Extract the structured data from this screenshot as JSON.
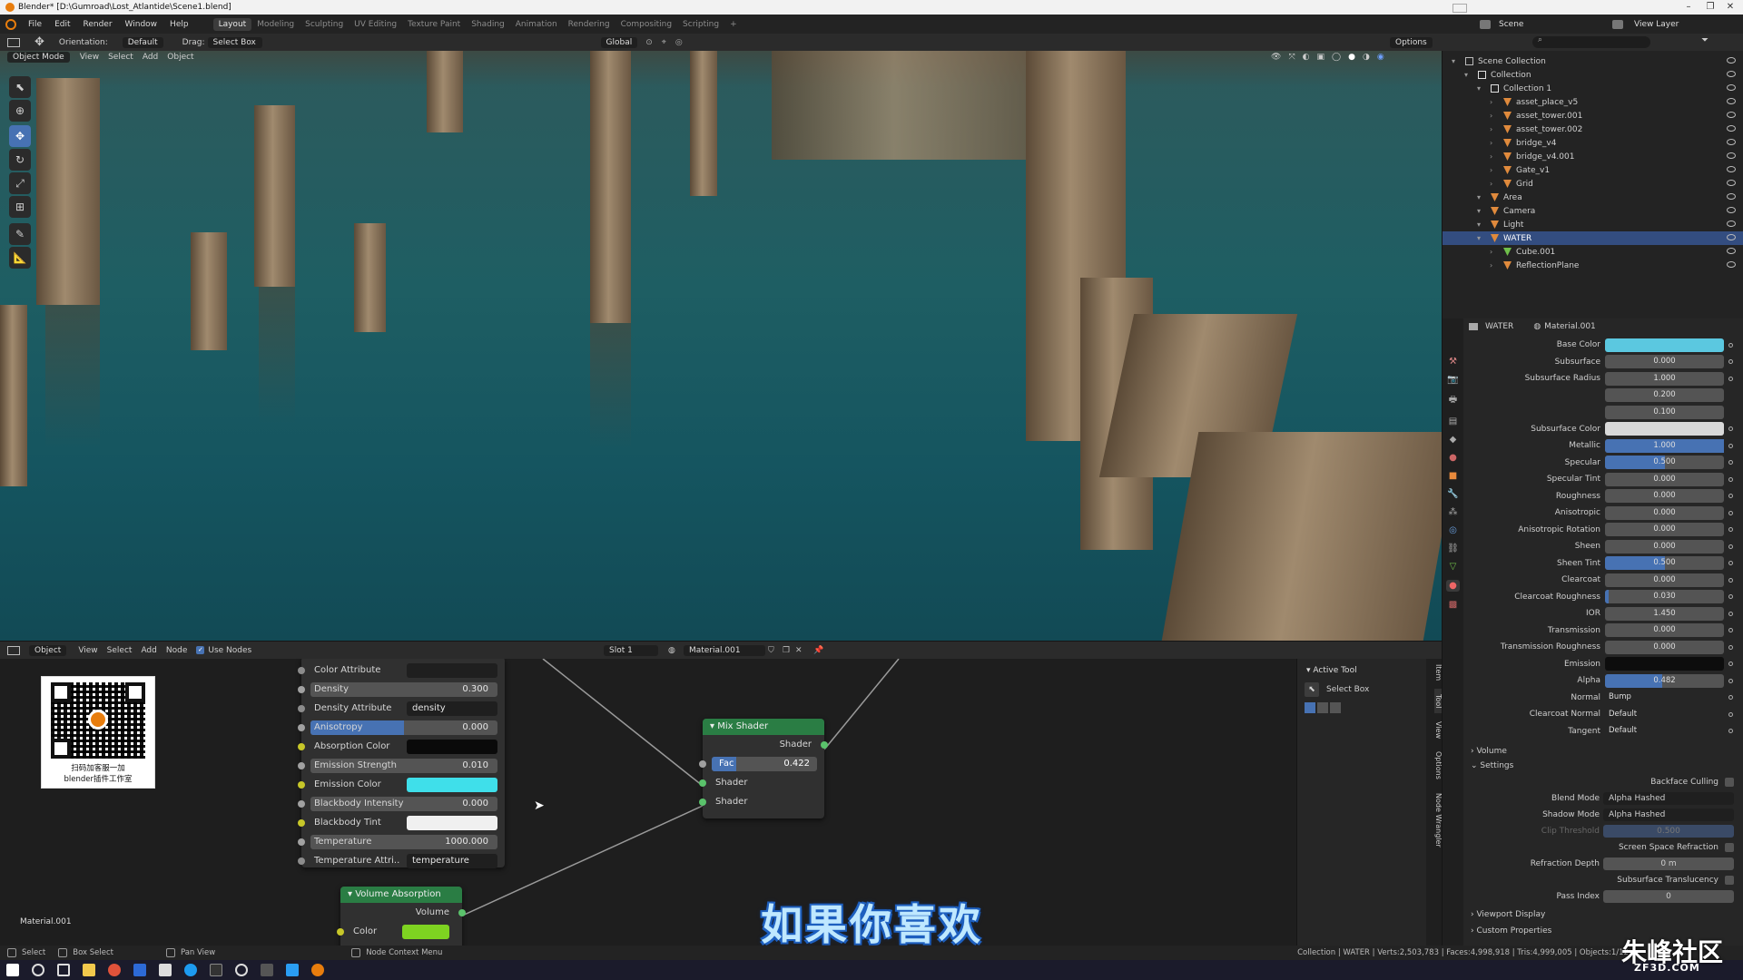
{
  "window": {
    "title": "Blender* [D:\\Gumroad\\Lost_Atlantide\\Scene1.blend]"
  },
  "menu": {
    "items": [
      "File",
      "Edit",
      "Render",
      "Window",
      "Help"
    ]
  },
  "workspaces": [
    "Layout",
    "Modeling",
    "Sculpting",
    "UV Editing",
    "Texture Paint",
    "Shading",
    "Animation",
    "Rendering",
    "Compositing",
    "Scripting"
  ],
  "topright": {
    "scene": "Scene",
    "view_layer": "View Layer"
  },
  "viewport_header": {
    "orientation_label": "Orientation:",
    "orientation_value": "Default",
    "drag_label": "Drag:",
    "drag_value": "Select Box",
    "transform_value": "Global",
    "options": "Options",
    "mode": "Object Mode",
    "menus": [
      "View",
      "Select",
      "Add",
      "Object"
    ]
  },
  "node_header": {
    "editor": "Object",
    "menus": [
      "View",
      "Select",
      "Add",
      "Node"
    ],
    "use_nodes": "Use Nodes",
    "slot": "Slot 1",
    "material": "Material.001"
  },
  "volume_node": {
    "rows": [
      {
        "label": "Color Attribute",
        "value": "",
        "socket": "#8c8c8c"
      },
      {
        "label": "Density",
        "value": "0.300",
        "socket": "#a1a1a1"
      },
      {
        "label": "Density Attribute",
        "value": "density",
        "socket": "#8c8c8c"
      },
      {
        "label": "Anisotropy",
        "value": "0.000",
        "socket": "#a1a1a1"
      },
      {
        "label": "Absorption Color",
        "value": "",
        "socket": "#c7c729"
      },
      {
        "label": "Emission Strength",
        "value": "0.010",
        "socket": "#a1a1a1"
      },
      {
        "label": "Emission Color",
        "value": "",
        "socket": "#c7c729"
      },
      {
        "label": "Blackbody Intensity",
        "value": "0.000",
        "socket": "#a1a1a1"
      },
      {
        "label": "Blackbody Tint",
        "value": "",
        "socket": "#c7c729"
      },
      {
        "label": "Temperature",
        "value": "1000.000",
        "socket": "#a1a1a1"
      },
      {
        "label": "Temperature Attri..",
        "value": "temperature",
        "socket": "#8c8c8c"
      }
    ]
  },
  "mix_node": {
    "title": "Mix Shader",
    "output": "Shader",
    "fac_label": "Fac",
    "fac_value": "0.422",
    "input1": "Shader",
    "input2": "Shader"
  },
  "vol_abs_node": {
    "title": "Volume Absorption",
    "output": "Volume",
    "input": "Color"
  },
  "node_material_label": "Material.001",
  "qr_caption1": "扫码加客服一加",
  "qr_caption2": "blender插件工作室",
  "subtitle": "如果你喜欢",
  "side_panel": {
    "title": "Active Tool",
    "tool": "Select Box",
    "tabs": [
      "Item",
      "Tool",
      "View",
      "Options",
      "Node Wrangler"
    ]
  },
  "outliner": {
    "rows": [
      {
        "label": "Scene Collection",
        "indent": 0,
        "icon": "#bbbbbb"
      },
      {
        "label": "Collection",
        "indent": 1,
        "icon": "#e0e0e0"
      },
      {
        "label": "Collection 1",
        "indent": 2,
        "icon": "#e0e0e0"
      },
      {
        "label": "asset_place_v5",
        "indent": 3,
        "icon": "#e08a3c"
      },
      {
        "label": "asset_tower.001",
        "indent": 3,
        "icon": "#e08a3c"
      },
      {
        "label": "asset_tower.002",
        "indent": 3,
        "icon": "#e08a3c"
      },
      {
        "label": "bridge_v4",
        "indent": 3,
        "icon": "#e08a3c"
      },
      {
        "label": "bridge_v4.001",
        "indent": 3,
        "icon": "#e08a3c"
      },
      {
        "label": "Gate_v1",
        "indent": 3,
        "icon": "#e08a3c"
      },
      {
        "label": "Grid",
        "indent": 3,
        "icon": "#e08a3c"
      },
      {
        "label": "Area",
        "indent": 2,
        "icon": "#e08a3c"
      },
      {
        "label": "Camera",
        "indent": 2,
        "icon": "#e08a3c"
      },
      {
        "label": "Light",
        "indent": 2,
        "icon": "#e08a3c"
      },
      {
        "label": "WATER",
        "indent": 2,
        "icon": "#e08a3c",
        "selected": true
      },
      {
        "label": "Cube.001",
        "indent": 3,
        "icon": "#6fbf4a"
      },
      {
        "label": "ReflectionPlane",
        "indent": 3,
        "icon": "#e08a3c"
      }
    ]
  },
  "properties": {
    "object": "WATER",
    "material": "Material.001",
    "rows": [
      {
        "label": "Base Color",
        "value": "",
        "type": "color",
        "color": "#5bc8e0"
      },
      {
        "label": "Subsurface",
        "value": "0.000"
      },
      {
        "label": "Subsurface Radius",
        "value": "1.000"
      },
      {
        "label": "",
        "value": "0.200"
      },
      {
        "label": "",
        "value": "0.100"
      },
      {
        "label": "Subsurface Color",
        "value": "",
        "type": "color",
        "color": "#d9d9d9"
      },
      {
        "label": "Metallic",
        "value": "1.000",
        "fill": 1.0
      },
      {
        "label": "Specular",
        "value": "0.500",
        "fill": 0.5
      },
      {
        "label": "Specular Tint",
        "value": "0.000"
      },
      {
        "label": "Roughness",
        "value": "0.000"
      },
      {
        "label": "Anisotropic",
        "value": "0.000"
      },
      {
        "label": "Anisotropic Rotation",
        "value": "0.000"
      },
      {
        "label": "Sheen",
        "value": "0.000"
      },
      {
        "label": "Sheen Tint",
        "value": "0.500",
        "fill": 0.5
      },
      {
        "label": "Clearcoat",
        "value": "0.000"
      },
      {
        "label": "Clearcoat Roughness",
        "value": "0.030",
        "fill": 0.03
      },
      {
        "label": "IOR",
        "value": "1.450"
      },
      {
        "label": "Transmission",
        "value": "0.000"
      },
      {
        "label": "Transmission Roughness",
        "value": "0.000"
      },
      {
        "label": "Emission",
        "value": "",
        "type": "color",
        "color": "#0d0d0d"
      },
      {
        "label": "Alpha",
        "value": "0.482",
        "fill": 0.482
      },
      {
        "label": "Normal",
        "value": "Bump",
        "type": "text"
      },
      {
        "label": "Clearcoat Normal",
        "value": "Default",
        "type": "text"
      },
      {
        "label": "Tangent",
        "value": "Default",
        "type": "text"
      }
    ],
    "sections": {
      "volume": "Volume",
      "settings": "Settings",
      "viewport_display": "Viewport Display",
      "custom_properties": "Custom Properties"
    },
    "settings": {
      "backface_culling": "Backface Culling",
      "blend_mode_label": "Blend Mode",
      "blend_mode": "Alpha Hashed",
      "shadow_mode_label": "Shadow Mode",
      "shadow_mode": "Alpha Hashed",
      "clip_threshold_label": "Clip Threshold",
      "clip_threshold": "0.500",
      "ssr": "Screen Space Refraction",
      "refraction_depth_label": "Refraction Depth",
      "refraction_depth": "0 m",
      "subsurface_translucency": "Subsurface Translucency",
      "pass_index_label": "Pass Index",
      "pass_index": "0"
    }
  },
  "status": {
    "select": "Select",
    "box_select": "Box Select",
    "pan_view": "Pan View",
    "context_menu": "Node Context Menu",
    "stats": "Collection | WATER | Verts:2,503,783 | Faces:4,998,918 | Tris:4,999,005 | Objects:1/12"
  },
  "watermark": {
    "text": "朱峰社区",
    "url": "ZF3D.COM"
  }
}
